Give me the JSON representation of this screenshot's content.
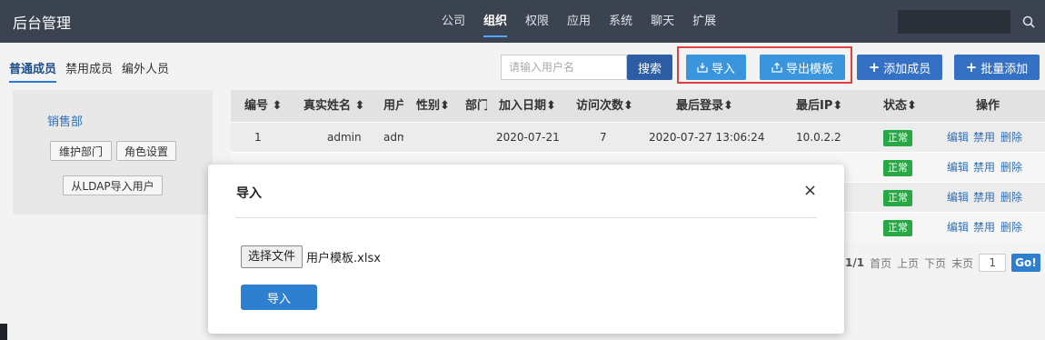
{
  "app": {
    "title": "后台管理"
  },
  "nav": {
    "items": [
      "公司",
      "组织",
      "权限",
      "应用",
      "系统",
      "聊天",
      "扩展"
    ],
    "active_index": 1
  },
  "subtabs": [
    "普通成员",
    "禁用成员",
    "编外人员"
  ],
  "toolbar": {
    "search_placeholder": "请输入用户名",
    "search_btn": "搜索",
    "import_btn": "导入",
    "export_btn": "导出模板",
    "add_btn": "添加成员",
    "batch_add_btn": "批量添加"
  },
  "dept": {
    "name": "销售部",
    "maintain_btn": "维护部门",
    "role_btn": "角色设置",
    "ldap_btn": "从LDAP导入用户"
  },
  "table": {
    "headers": [
      "编号",
      "真实姓名",
      "用户",
      "性别",
      "部门",
      "加入日期",
      "访问次数",
      "最后登录",
      "最后IP",
      "状态",
      "操作"
    ],
    "rows": [
      {
        "id": "1",
        "name": "admin",
        "user": "admin",
        "gender": "",
        "dept": "",
        "joined": "2020-07-21",
        "visits": "7",
        "last_login": "2020-07-27 13:06:24",
        "last_ip": "10.0.2.2",
        "status": "正常"
      },
      {
        "status": "正常"
      },
      {
        "status": "正常"
      },
      {
        "status": "正常"
      }
    ],
    "actions": {
      "edit": "编辑",
      "disable": "禁用",
      "delete": "删除"
    }
  },
  "pager": {
    "page_info": "1/1",
    "first": "首页",
    "prev": "上页",
    "next": "下页",
    "last": "末页",
    "page_value": "1",
    "go": "Go!"
  },
  "modal": {
    "title": "导入",
    "close": "×",
    "choose_file": "选择文件",
    "file_name": "用户模板.xlsx",
    "submit": "导入"
  },
  "colors": {
    "topbar": "#3c4350",
    "accent": "#2f7fd0",
    "status_ok": "#28a745",
    "highlight": "#e04040"
  }
}
